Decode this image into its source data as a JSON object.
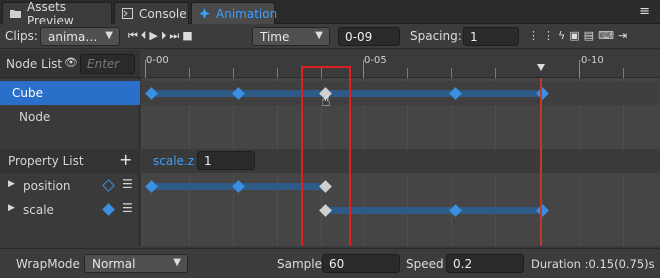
{
  "tabs": [
    {
      "label": "Assets Preview",
      "icon": "folder-icon"
    },
    {
      "label": "Console",
      "icon": "console-icon"
    },
    {
      "label": "Animation",
      "icon": "animation-icon",
      "active": true
    }
  ],
  "toolbar": {
    "clips_label": "Clips:",
    "clip_value": "anima…",
    "mode_value": "Time",
    "time_value": "0-09",
    "spacing_label": "Spacing:",
    "spacing_value": "1"
  },
  "node_list": {
    "title": "Node List",
    "search_placeholder": "Enter",
    "items": [
      "Cube",
      "Node"
    ]
  },
  "property_list": {
    "title": "Property List",
    "add_label": "+",
    "items": [
      "position",
      "scale"
    ]
  },
  "prop_editor": {
    "name": "scale.z",
    "value": "1"
  },
  "ruler": {
    "labels": [
      "0-00",
      "0-05",
      "0-10"
    ]
  },
  "bottom": {
    "wrapmode_label": "WrapMode",
    "wrapmode_value": "Normal",
    "sample_label": "Sample",
    "sample_value": "60",
    "speed_label": "Speed",
    "speed_value": "0.2",
    "duration_text": "Duration :0.15(0.75)s"
  },
  "colors": {
    "accent": "#3ba0ff",
    "selection": "#2a6fc9",
    "keyframe": "#3b8fe0",
    "playhead": "#c0392b",
    "highlight_box": "#e02020"
  }
}
